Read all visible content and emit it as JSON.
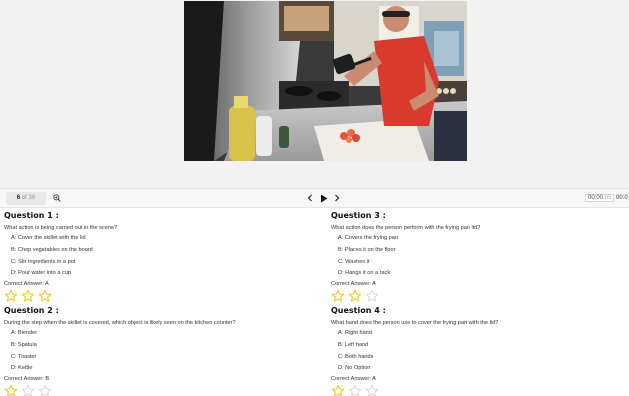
{
  "player": {
    "frame_current": "6",
    "frame_of": "of",
    "frame_total": "36",
    "time_current": "00:00",
    "time_fraction": ":05",
    "time_total": "00:0",
    "icons": {
      "zoom": "zoom-in-icon",
      "prev": "chevron-left-icon",
      "play": "play-icon",
      "next": "chevron-right-icon"
    }
  },
  "questions": [
    {
      "title": "Question 1 :",
      "text": "What action is being carried out in the scene?",
      "options": [
        "A: Cover the skillet with the lid",
        "B: Chop vegetables on the board",
        "C: Stir ingredients in a pot",
        "D: Pour water into a cup"
      ],
      "answer": "Correct Answer: A",
      "rating": 3
    },
    {
      "title": "Question 2 :",
      "text": "During the step when the skillet is covered, which object is likely seen on the kitchen counter?",
      "options": [
        "A: Blender",
        "B: Spatula",
        "C: Toaster",
        "D: Kettle"
      ],
      "answer": "Correct Answer: B",
      "rating": 1
    },
    {
      "title": "Question 3 :",
      "text": "What action does the person perform with the frying pan lid?",
      "options": [
        "A: Covers the frying pan",
        "B: Places it on the floor",
        "C: Washes it",
        "D: Hangs it on a rack"
      ],
      "answer": "Correct Answer: A",
      "rating": 2
    },
    {
      "title": "Question 4 :",
      "text": "What hand does the person use to cover the frying pan with the lid?",
      "options": [
        "A: Right hand",
        "B: Left hand",
        "C: Both hands",
        "D: No Option"
      ],
      "answer": "Correct Answer: A",
      "rating": 1
    }
  ],
  "colors": {
    "star_filled": "#f5c518",
    "star_empty": "#d9d9d9",
    "accent": "#f5c518"
  }
}
